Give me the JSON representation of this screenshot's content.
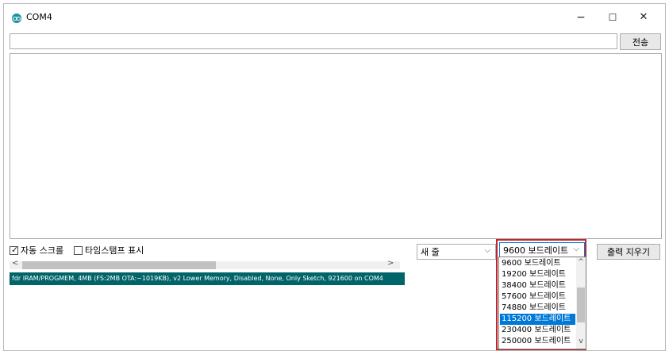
{
  "window": {
    "title": "COM4",
    "minimize_glyph": "−",
    "maximize_glyph": "☐",
    "close_glyph": "✕"
  },
  "input": {
    "value": "",
    "send_label": "전송"
  },
  "options": {
    "autoscroll_label": "자동 스크롤",
    "autoscroll_checked": true,
    "timestamp_label": "타임스탬프 표시",
    "timestamp_checked": false,
    "line_ending": "새 줄",
    "baud_selected": "9600 보드레이트",
    "clear_label": "출력 지우기"
  },
  "scrollbar": {
    "left_glyph": "<",
    "right_glyph": ">"
  },
  "status_text": "fdr IRAM/PROGMEM, 4MB (FS:2MB OTA:~1019KB), v2 Lower Memory, Disabled, None, Only Sketch, 921600 on COM4",
  "baud_dropdown": {
    "items": [
      "9600 보드레이트",
      "19200 보드레이트",
      "38400 보드레이트",
      "57600 보드레이트",
      "74880 보드레이트",
      "115200 보드레이트",
      "230400 보드레이트",
      "250000 보드레이트"
    ],
    "highlighted_index": 5,
    "up_glyph": "^",
    "down_glyph": "v"
  },
  "colors": {
    "status_bar": "#006468",
    "selection": "#0078d7",
    "highlight_border": "#c0262b",
    "app_icon": "#1a8fa3"
  },
  "icons": [
    "arduino-app-icon",
    "minimize-icon",
    "maximize-icon",
    "close-icon",
    "chevron-down-icon",
    "checkbox-checked-icon"
  ]
}
